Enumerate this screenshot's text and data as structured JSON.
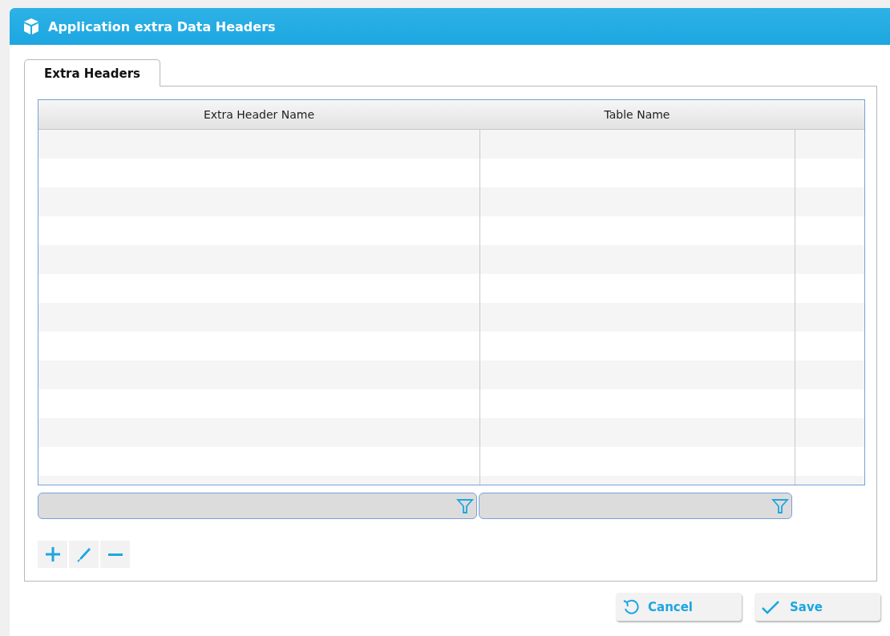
{
  "window": {
    "title": "Application extra Data Headers"
  },
  "tabs": [
    {
      "label": "Extra Headers",
      "selected": true
    }
  ],
  "table": {
    "columns": [
      "Extra Header Name",
      "Table Name"
    ]
  },
  "buttons": [
    {
      "label": "Cancel",
      "kind": "cancel"
    },
    {
      "label": "Save",
      "kind": "save"
    }
  ]
}
